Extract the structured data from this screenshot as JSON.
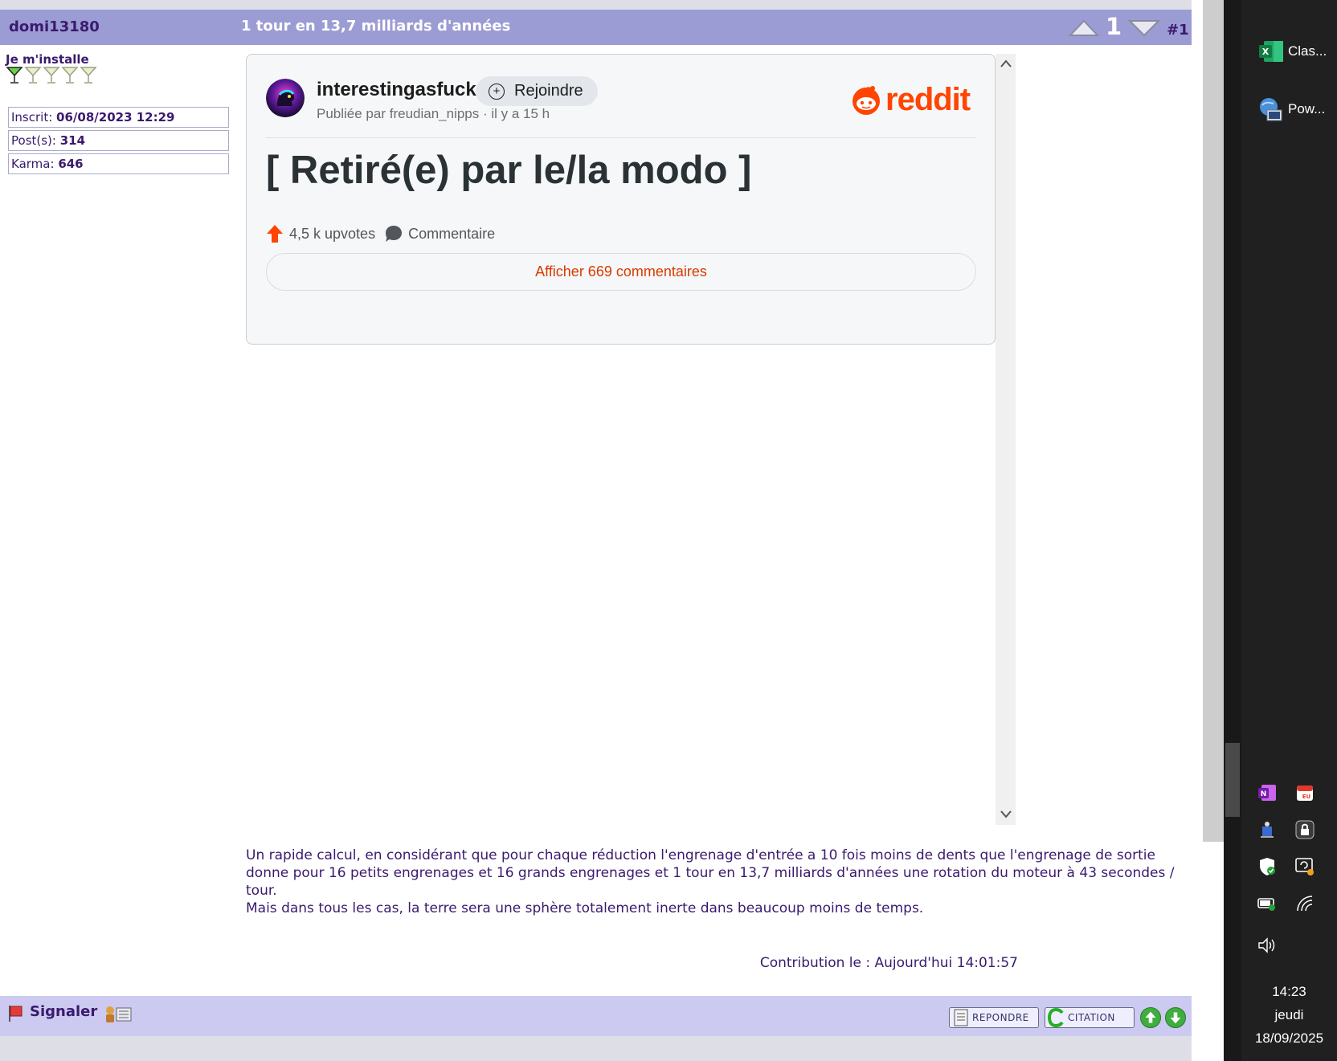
{
  "post": {
    "author": "domi13180",
    "topic_title": "1 tour en 13,7 milliards d'années",
    "vote_count": "1",
    "post_number": "#1",
    "rank": "Je m'installe",
    "rank_level": 1,
    "rank_max": 5,
    "stats": [
      {
        "label": "Inscrit:",
        "value": "06/08/2023 12:29"
      },
      {
        "label": "Post(s):",
        "value": "314"
      },
      {
        "label": "Karma:",
        "value": "646"
      }
    ],
    "body_lines": [
      "Un rapide calcul, en considérant que pour chaque réduction l'engrenage d'entrée a 10 fois moins de dents que l'engrenage de sortie donne pour 16 petits engrenages et 16 grands engrenages et 1 tour en 13,7 milliards d'années une rotation du moteur à 43 secondes / tour.",
      "Mais dans tous les cas, la terre sera une sphère totalement inerte dans beaucoup moins de temps."
    ],
    "contribution_date": "Contribution le : Aujourd'hui 14:01:57",
    "report_label": "Signaler",
    "reply_label": "REPONDRE",
    "quote_label": "CITATION"
  },
  "embed": {
    "subreddit": "interestingasfuck",
    "join_label": "Rejoindre",
    "join_icon": "+",
    "posted_by": "Publiée par freudian_nipps · il y a 15 h",
    "logo_text": "reddit",
    "title": "[ Retiré(e) par le/la modo ]",
    "upvotes": "4,5 k upvotes",
    "comment_label": "Commentaire",
    "view_comments": "Afficher 669 commentaires"
  },
  "taskbar": {
    "apps": [
      {
        "label": "Clas...",
        "icon": "excel-icon"
      },
      {
        "label": "Pow...",
        "icon": "powershell-icon"
      }
    ],
    "tray_icons": [
      "onenote-icon",
      "calendar-eu-icon",
      "network-device-icon",
      "lock-icon",
      "shield-icon",
      "sync-icon",
      "battery-icon",
      "wifi-icon",
      "volume-icon"
    ],
    "time": "14:23",
    "day": "jeudi",
    "date": "18/09/2025"
  },
  "colors": {
    "header_bar": "#9c9cd4",
    "footer_bar": "#cccaf0",
    "forum_text": "#3a1a6e",
    "reddit_orange": "#ff4500",
    "taskbar_bg": "#202020"
  }
}
